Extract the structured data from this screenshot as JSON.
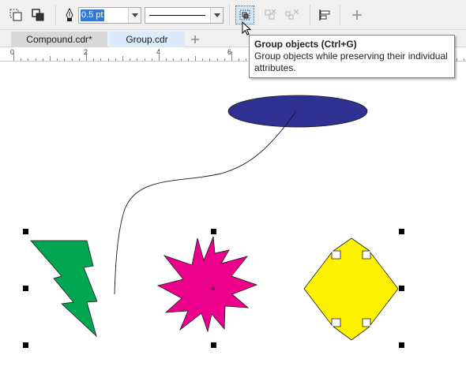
{
  "toolbar": {
    "outline_width": "0.5 pt"
  },
  "tabs": [
    {
      "label": "Compound.cdr*"
    },
    {
      "label": "Group.cdr"
    }
  ],
  "ruler": {
    "labels": [
      "0",
      "2",
      "4",
      "6"
    ]
  },
  "tooltip": {
    "title": "Group objects (Ctrl+G)",
    "body": "Group objects while preserving their individual attributes."
  },
  "colors": {
    "ellipse_fill": "#2e3192",
    "lightning_fill": "#00a651",
    "starburst_fill": "#ec008c",
    "cross_fill": "#fff200"
  }
}
